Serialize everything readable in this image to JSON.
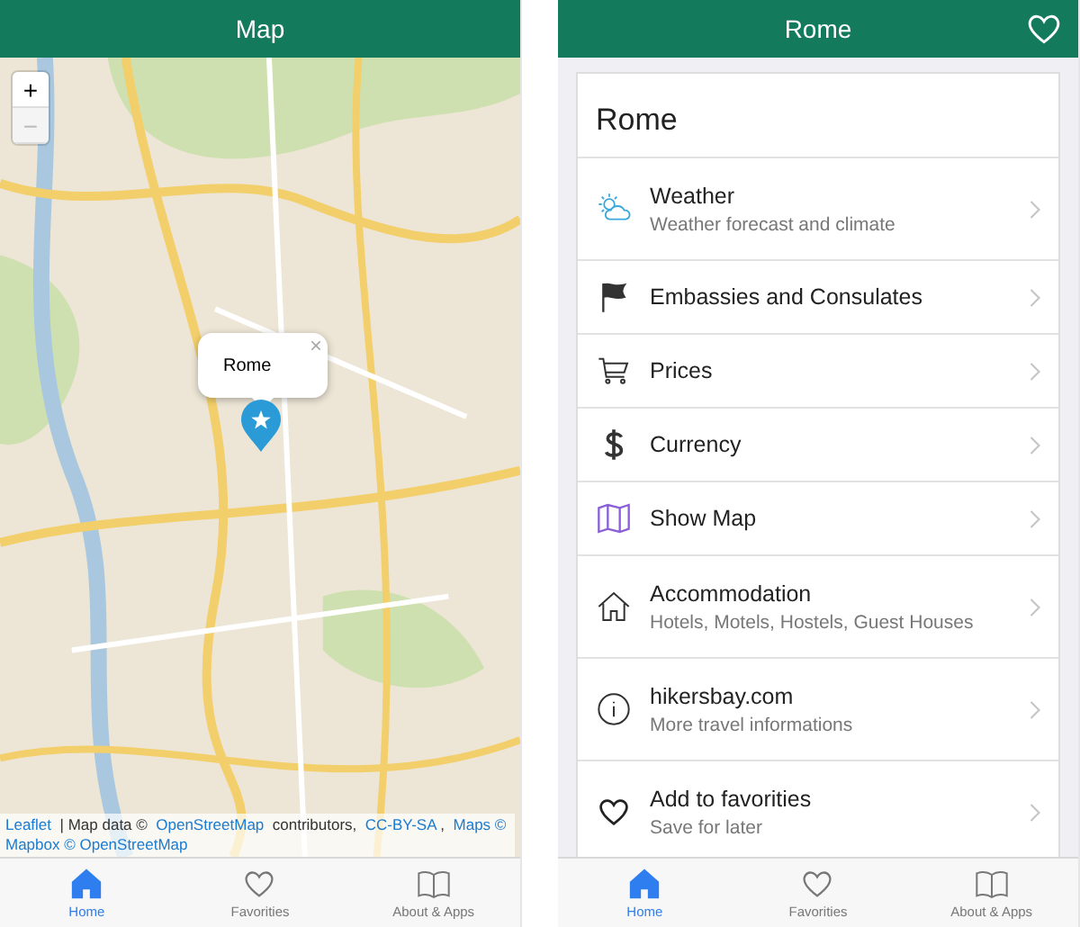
{
  "map_screen": {
    "title": "Map",
    "zoom_in": "+",
    "zoom_out": "−",
    "zoom_out_disabled": true,
    "popup": {
      "title": "Rome",
      "close": "×"
    },
    "attribution": [
      {
        "text": "Leaflet",
        "link": true
      },
      {
        "text": " | Map data © ",
        "link": false
      },
      {
        "text": "OpenStreetMap",
        "link": true
      },
      {
        "text": " contributors, ",
        "link": false
      },
      {
        "text": "CC-BY-SA",
        "link": true
      },
      {
        "text": ", ",
        "link": false
      },
      {
        "text": "Maps ©",
        "link": true
      },
      {
        "text": "Mapbox © OpenStreetMap",
        "link": true
      }
    ],
    "tabs": [
      {
        "label": "Home",
        "selected": true
      },
      {
        "label": "Favorities",
        "selected": false
      },
      {
        "label": "About & Apps",
        "selected": false
      }
    ]
  },
  "detail_screen": {
    "title": "Rome",
    "heading": "Rome",
    "items": [
      {
        "title": "Weather",
        "subtitle": "Weather forecast and climate"
      },
      {
        "title": "Embassies and Consulates"
      },
      {
        "title": "Prices"
      },
      {
        "title": "Currency"
      },
      {
        "title": "Show Map"
      },
      {
        "title": "Accommodation",
        "subtitle": "Hotels, Motels, Hostels, Guest Houses"
      },
      {
        "title": "hikersbay.com",
        "subtitle": "More travel informations"
      },
      {
        "title": "Add to favorities",
        "subtitle": "Save for later"
      }
    ],
    "tabs": [
      {
        "label": "Home",
        "selected": true
      },
      {
        "label": "Favorities",
        "selected": false
      },
      {
        "label": "About & Apps",
        "selected": false
      }
    ]
  }
}
